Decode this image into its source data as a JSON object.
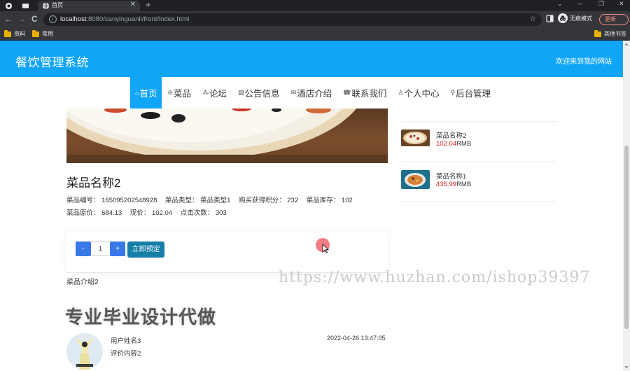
{
  "browser": {
    "tab_title": "首页",
    "tab_close": "✕",
    "new_tab": "+",
    "window_controls": [
      "⌄",
      "–",
      "❐",
      "✕"
    ],
    "nav_buttons": [
      "←",
      "→",
      "C"
    ],
    "url_host": "localhost",
    "url_rest": ":8080/canyinguanli/front/index.html",
    "star": "☆",
    "incognito_label": "无痕模式",
    "update_label": "更新",
    "bookmarks": [
      "资料",
      "常用"
    ],
    "other_bookmarks": "其他书签"
  },
  "site": {
    "title": "餐饮管理系统",
    "welcome": "欢迎来到我的网站",
    "nav": [
      {
        "icon": "⌂",
        "label": "首页"
      },
      {
        "icon": "⊜",
        "label": "菜品"
      },
      {
        "icon": "⁂",
        "label": "论坛"
      },
      {
        "icon": "▤",
        "label": "公告信息"
      },
      {
        "icon": "✉",
        "label": "酒店介绍"
      },
      {
        "icon": "☎",
        "label": "联系我们"
      },
      {
        "icon": "♙",
        "label": "个人中心"
      },
      {
        "icon": "⚲",
        "label": "后台管理"
      }
    ]
  },
  "dish": {
    "name": "菜品名称2",
    "info_line1": [
      "菜品编号：  165095202548928",
      "菜品类型：  菜品类型1",
      "购买获得积分：  232",
      "菜品库存：  102"
    ],
    "info_line2": [
      "菜品原价：  684.13",
      "现价：  102.04",
      "点击次数：  303"
    ],
    "quantity": "1",
    "minus": "-",
    "plus": "+",
    "order_button": "立即预定",
    "intro": "菜品介绍2"
  },
  "comments": {
    "heading": "专业毕业设计代做",
    "items": [
      {
        "user": "用户姓名3",
        "content": "评价内容2",
        "time": "2022-04-26 13:47:05"
      }
    ]
  },
  "sidebar": {
    "items": [
      {
        "name": "菜品名称2",
        "price": "102.04",
        "unit": "RMB"
      },
      {
        "name": "菜品名称1",
        "price": "435.99",
        "unit": "RMB"
      }
    ]
  },
  "watermark": "https://www.huzhan.com/ishop39397",
  "colors": {
    "header": "#11a5f7",
    "price": "#e02020",
    "button": "#157fa8",
    "qty_button": "#3a78e8"
  }
}
